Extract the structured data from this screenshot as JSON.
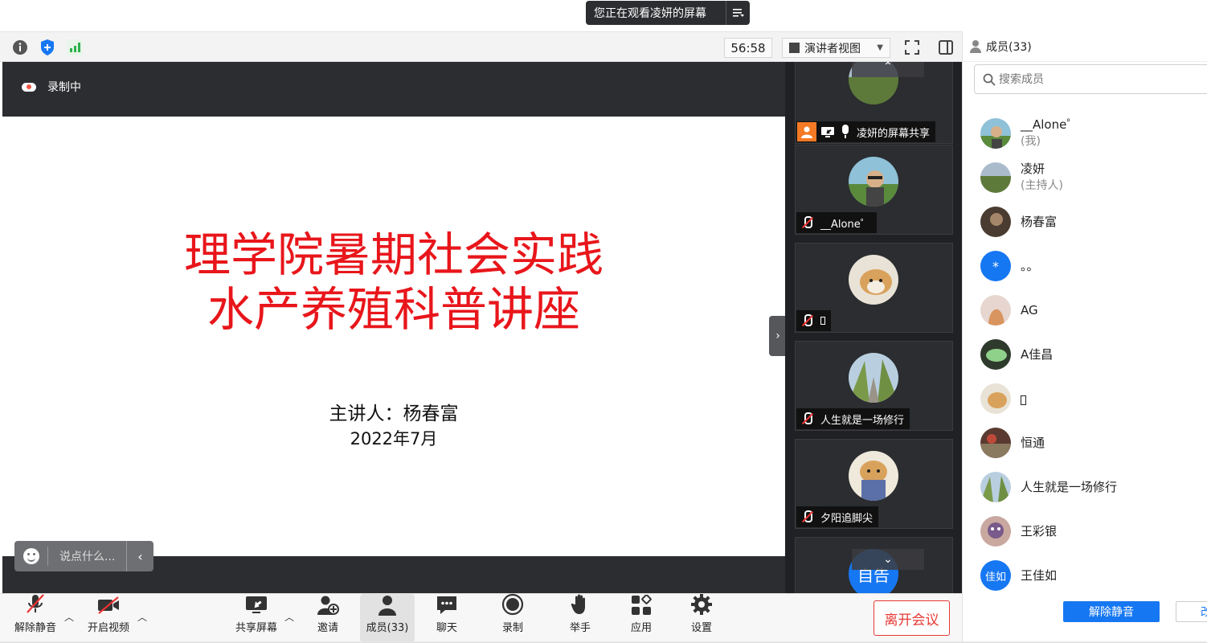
{
  "banner": {
    "text": "您正在观看凌妍的屏幕",
    "menu_icon": "list-icon"
  },
  "toolbar": {
    "timer": "56:58",
    "view_mode": "演讲者视图",
    "icons": [
      "info-icon",
      "shield-icon",
      "signal-icon",
      "fullscreen-icon",
      "sidebar-toggle-icon"
    ]
  },
  "stage": {
    "recording_label": "录制中",
    "slide": {
      "title_line1": "理学院暑期社会实践",
      "title_line2": "水产养殖科普讲座",
      "presenter": "主讲人：杨春富",
      "date": "2022年7月"
    },
    "chat_placeholder": "说点什么..."
  },
  "video_tiles": [
    {
      "name": "凌妍的屏幕共享",
      "status": "sharing"
    },
    {
      "name": "__Alone゜",
      "status": "muted"
    },
    {
      "name": "",
      "status": "muted"
    },
    {
      "name": "人生就是一场修行",
      "status": "muted"
    },
    {
      "name": "夕阳追脚尖",
      "status": "muted"
    },
    {
      "name": "自告",
      "status": "unknown"
    }
  ],
  "controls": {
    "unmute": "解除静音",
    "start_video": "开启视频",
    "share_screen": "共享屏幕",
    "invite": "邀请",
    "members": "成员(33)",
    "chat": "聊天",
    "record": "录制",
    "raise_hand": "举手",
    "apps": "应用",
    "settings": "设置",
    "leave": "离开会议"
  },
  "panel": {
    "title": "成员(33)",
    "search_placeholder": "搜索成员",
    "members": [
      {
        "name": "__Alone゜",
        "sub": "(我)"
      },
      {
        "name": "凌妍",
        "sub": "(主持人)"
      },
      {
        "name": "杨春富",
        "sub": ""
      },
      {
        "name": "。。",
        "sub": ""
      },
      {
        "name": "AG",
        "sub": ""
      },
      {
        "name": "A佳昌",
        "sub": ""
      },
      {
        "name": "",
        "sub": ""
      },
      {
        "name": "恒通",
        "sub": ""
      },
      {
        "name": "人生就是一场修行",
        "sub": ""
      },
      {
        "name": "王彩银",
        "sub": ""
      },
      {
        "name": "王佳如",
        "sub": ""
      }
    ],
    "avatar_labels": {
      "dot_member": "*",
      "wang_jiaru": "佳如"
    },
    "unmute_button": "解除静音",
    "more_button": "改"
  },
  "colors": {
    "slide_title": "#e8161b",
    "primary_blue": "#1677f2",
    "leave_red": "#e53935",
    "share_orange": "#f57a25"
  }
}
